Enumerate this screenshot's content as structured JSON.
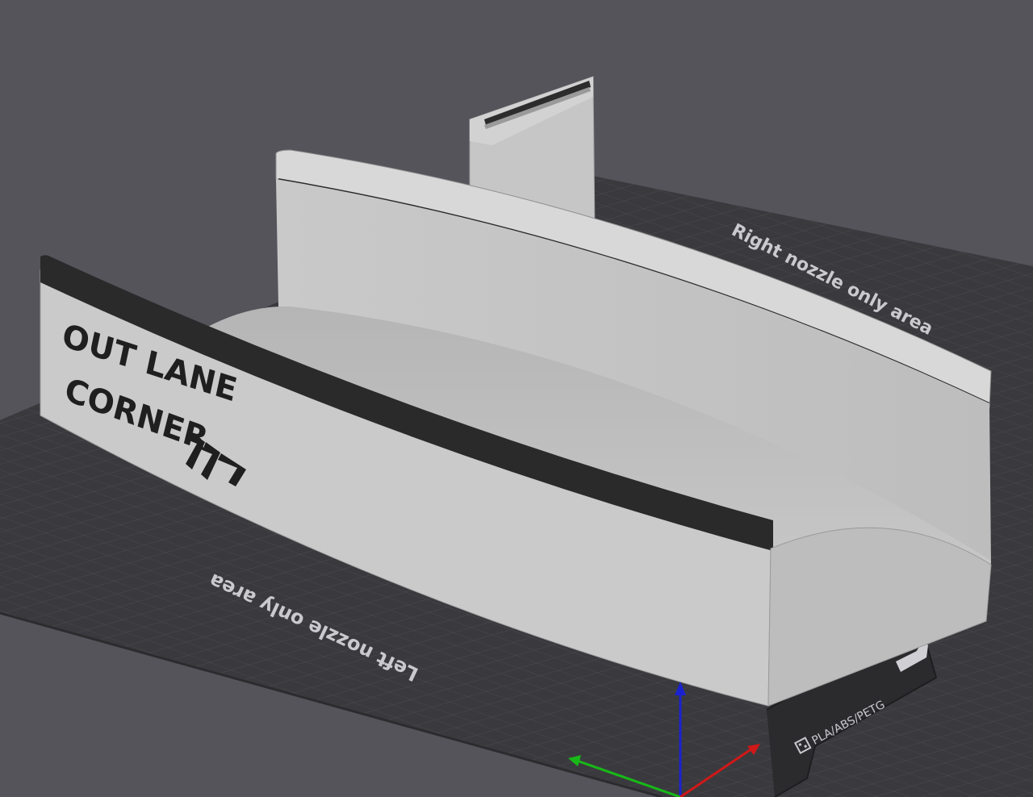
{
  "viewport": {
    "background_color": "#55545b",
    "bed_color": "#3a3a3e",
    "model_color": "#c4c4c4",
    "model_stripe_color": "#2a2a2b"
  },
  "bed": {
    "right_zone_label": "Right nozzle only area",
    "left_zone_label": "Left nozzle only area",
    "plate_label": "PLA/ABS/PETG",
    "plate_icon": "plate-logo-icon"
  },
  "model": {
    "text_line_1": "OUT LANE",
    "text_line_2": "CORNER",
    "arrow_icon": "chevron-arrows-icon"
  },
  "axes": {
    "x_color": "#d01818",
    "y_color": "#18b818",
    "z_color": "#1a22d0"
  }
}
